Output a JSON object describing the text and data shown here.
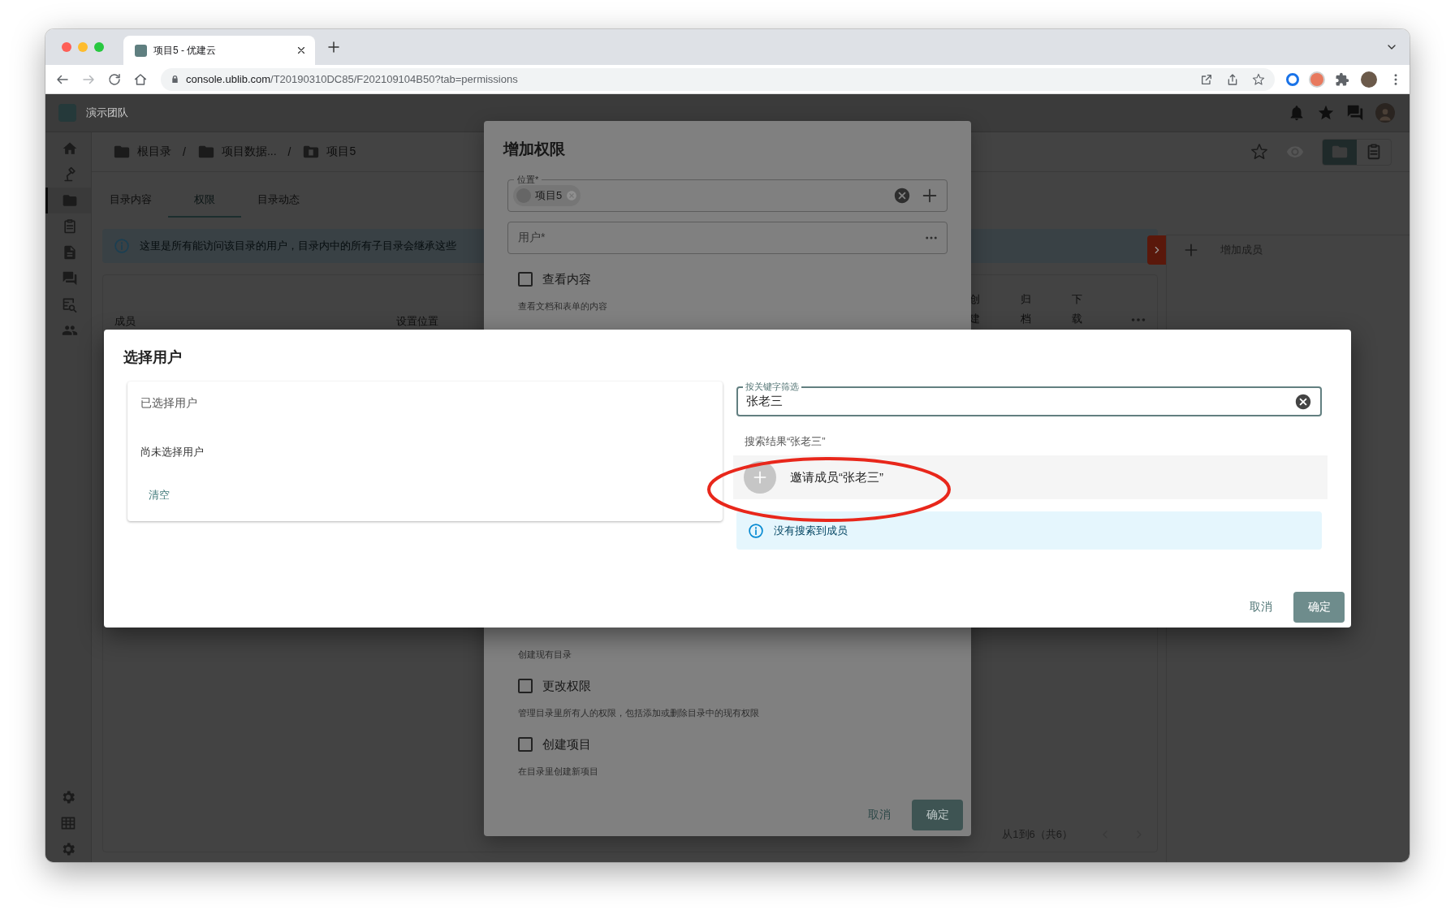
{
  "browser": {
    "tab_title": "项目5 - 优建云",
    "url_host": "console.ublib.com",
    "url_path": "/T20190310DC85/F202109104B50?tab=permissions"
  },
  "app": {
    "team": "演示团队",
    "rail": [
      {
        "kind": "home",
        "selected": false
      },
      {
        "kind": "lamp",
        "selected": false
      },
      {
        "kind": "folder",
        "selected": true
      },
      {
        "kind": "clipboard",
        "selected": false
      },
      {
        "kind": "document",
        "selected": false
      },
      {
        "kind": "chat",
        "selected": false
      },
      {
        "kind": "search-document",
        "selected": false
      },
      {
        "kind": "people",
        "selected": false
      }
    ],
    "rail_bottom": [
      {
        "kind": "gear"
      },
      {
        "kind": "table"
      },
      {
        "kind": "gear"
      }
    ],
    "breadcrumb": [
      {
        "kind": "folder",
        "label": "根目录"
      },
      {
        "kind": "separator",
        "label": "/"
      },
      {
        "kind": "folder",
        "label": "项目数据..."
      },
      {
        "kind": "separator",
        "label": "/"
      },
      {
        "kind": "project",
        "label": "项目5"
      }
    ],
    "view_toggle": [
      {
        "kind": "folder",
        "selected": true
      },
      {
        "kind": "clipboard",
        "selected": false
      }
    ],
    "tabs": [
      {
        "label": "目录内容",
        "selected": false
      },
      {
        "label": "权限",
        "selected": true
      },
      {
        "label": "目录动态",
        "selected": false
      }
    ],
    "notice": "这里是所有能访问该目录的用户，目录内中的所有子目录会继承这些",
    "table": {
      "columns": [
        {
          "label": "成员",
          "kind": "wide"
        },
        {
          "label": "设置位置",
          "kind": "flex"
        },
        {
          "label": "创建",
          "kind": "narrow"
        },
        {
          "label": "归档",
          "kind": "narrow"
        },
        {
          "label": "下载",
          "kind": "narrow"
        }
      ],
      "pagination": "从1到6（共6）"
    },
    "side_panel": {
      "action": "增加成员"
    }
  },
  "permission_dialog": {
    "title": "增加权限",
    "location": {
      "label": "位置*",
      "chip": "项目5"
    },
    "user": {
      "placeholder": "用户*"
    },
    "options": [
      {
        "label": "查看内容",
        "checked": false,
        "description": "查看文档和表单的内容"
      },
      {
        "description": "创建现有目录"
      },
      {
        "label": "更改权限",
        "checked": false,
        "description": "管理目录里所有人的权限，包括添加或删除目录中的现有权限"
      },
      {
        "label": "创建项目",
        "checked": false,
        "description": "在目录里创建新项目"
      }
    ],
    "buttons": [
      {
        "label": "取消",
        "kind": "text"
      },
      {
        "label": "确定",
        "kind": "filled"
      }
    ]
  },
  "select_user_dialog": {
    "title": "选择用户",
    "selected_panel": {
      "title": "已选择用户",
      "empty": "尚未选择用户",
      "clear": "清空"
    },
    "search": {
      "label": "按关键字筛选",
      "value": "张老三"
    },
    "results_heading": "搜索结果“张老三”",
    "invite": "邀请成员“张老三”",
    "notice": "没有搜索到成员",
    "buttons": [
      {
        "label": "取消",
        "kind": "text"
      },
      {
        "label": "确定",
        "kind": "filled"
      }
    ]
  }
}
